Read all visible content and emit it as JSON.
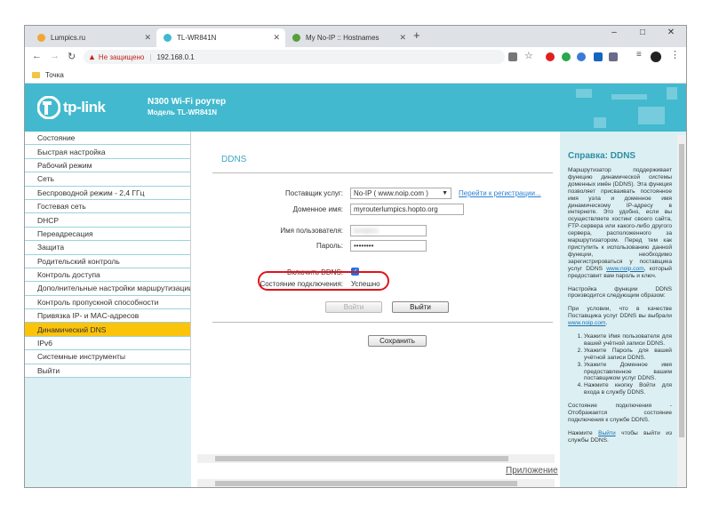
{
  "browser": {
    "tabs": [
      {
        "title": "Lumpics.ru",
        "favicon_color": "#f4a533"
      },
      {
        "title": "TL-WR841N",
        "favicon_color": "#42b9cf"
      },
      {
        "title": "My No-IP :: Hostnames",
        "favicon_color": "#5a9e3a"
      }
    ],
    "new_tab": "+",
    "window_controls": [
      "–",
      "□",
      "✕"
    ],
    "address": {
      "security": "Не защищено",
      "url": "192.168.0.1"
    },
    "bookmark": "Точка"
  },
  "router": {
    "brand": "tp-link",
    "model_line1": "N300 Wi-Fi роутер",
    "model_line2": "Модель TL-WR841N"
  },
  "menu": {
    "items": [
      "Состояние",
      "Быстрая настройка",
      "Рабочий режим",
      "Сеть",
      "Беспроводной режим - 2,4 ГГц",
      "Гостевая сеть",
      "DHCP",
      "Переадресация",
      "Защита",
      "Родительский контроль",
      "Контроль доступа",
      "Дополнительные настройки маршрутизации",
      "Контроль пропускной способности",
      "Привязка IP- и MAC-адресов",
      "Динамический DNS",
      "IPv6",
      "Системные инструменты",
      "Выйти"
    ],
    "selected": "Динамический DNS"
  },
  "ddns": {
    "title": "DDNS",
    "provider_label": "Поставщик услуг:",
    "provider_value": "No-IP ( www.noip.com )",
    "register_link": "Перейти к регистрации...",
    "domain_label": "Доменное имя:",
    "domain_value": "myrouterlumpics.hopto.org",
    "username_label": "Имя пользователя:",
    "username_value": "lumpics",
    "password_label": "Пароль:",
    "password_value": "••••••••",
    "enable_label": "Включить DDNS:",
    "status_label": "Состояние подключения:",
    "status_value": "Успешно",
    "login_button": "Войти",
    "logout_button": "Выйти",
    "save_button": "Сохранить",
    "app_link": "Приложение"
  },
  "help": {
    "title": "Справка: DDNS",
    "p1": "Маршрутизатор поддерживает функцию динамической системы доменных имён (DDNS). Эта функция позволяет присваивать постоянное имя узла и доменное имя динамическому IP-адресу в интернете. Это удобно, если вы осуществляете хостинг своего сайта, FTP-сервера или какого-либо другого сервера, расположенного за маршрутизатором. Перед тем как приступить к использованию данной функции, необходимо зарегистрироваться у поставщика услуг DDNS",
    "p1_link": "www.noip.com",
    "p1_tail": ", который предоставит вам пароль и ключ.",
    "p2": "Настройка функции DDNS производится следующим образом:",
    "p3_pre": "При условии, что в качестве Поставщика услуг DDNS вы выбрали",
    "p3_link": "www.noip.com",
    "steps": [
      "Укажите Имя пользователя для вашей учётной записи DDNS.",
      "Укажите Пароль для вашей учётной записи DDNS.",
      "Укажите Доменное имя предоставленное вашим поставщиком услуг DDNS.",
      "Нажмите кнопку Войти для входа в службу DDNS."
    ],
    "p4": "Состояние подключения - Отображается состояние подключения к службе DDNS.",
    "p5_pre": "Нажмите",
    "p5_link": "Выйти",
    "p5_tail": "чтобы выйти из службы DDNS."
  },
  "colors": {
    "header": "#42b9cf",
    "selected_menu": "#fcc30b",
    "highlight": "#e0131a"
  }
}
